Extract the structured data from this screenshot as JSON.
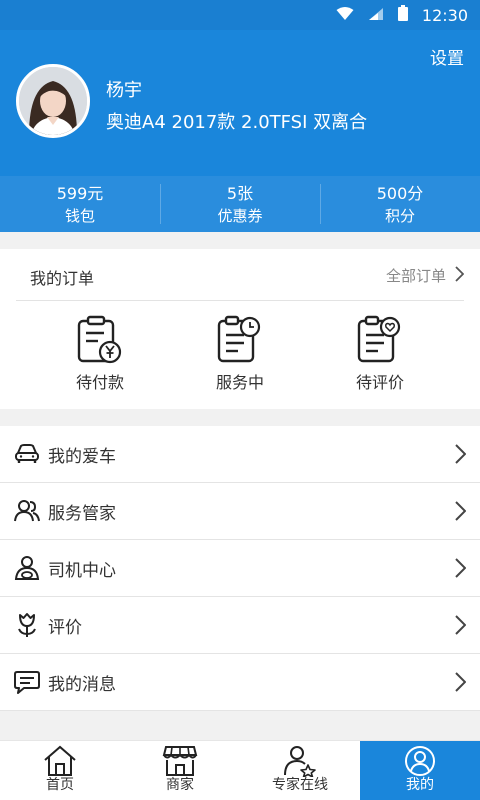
{
  "status_bar": {
    "time": "12:30"
  },
  "header": {
    "settings_label": "设置",
    "user_name": "杨宇",
    "user_car": "奥迪A4 2017款 2.0TFSI 双离合"
  },
  "stats": [
    {
      "value": "599元",
      "label": "钱包"
    },
    {
      "value": "5张",
      "label": "优惠券"
    },
    {
      "value": "500分",
      "label": "积分"
    }
  ],
  "orders": {
    "title": "我的订单",
    "all_label": "全部订单",
    "items": [
      {
        "label": "待付款",
        "icon": "clipboard-yen-icon"
      },
      {
        "label": "服务中",
        "icon": "clipboard-clock-icon"
      },
      {
        "label": "待评价",
        "icon": "clipboard-heart-icon"
      }
    ]
  },
  "menu": [
    {
      "label": "我的爱车",
      "icon": "car-icon"
    },
    {
      "label": "服务管家",
      "icon": "people-icon"
    },
    {
      "label": "司机中心",
      "icon": "driver-icon"
    },
    {
      "label": "评价",
      "icon": "tulip-icon"
    },
    {
      "label": "我的消息",
      "icon": "message-icon"
    }
  ],
  "tabbar": [
    {
      "label": "首页",
      "icon": "home-icon",
      "active": false
    },
    {
      "label": "商家",
      "icon": "store-icon",
      "active": false
    },
    {
      "label": "专家在线",
      "icon": "expert-icon",
      "active": false
    },
    {
      "label": "我的",
      "icon": "profile-icon",
      "active": true
    }
  ],
  "colors": {
    "primary": "#1a86db",
    "status_bar": "#1a7fd1",
    "stats_bg": "#2a8ddd"
  }
}
